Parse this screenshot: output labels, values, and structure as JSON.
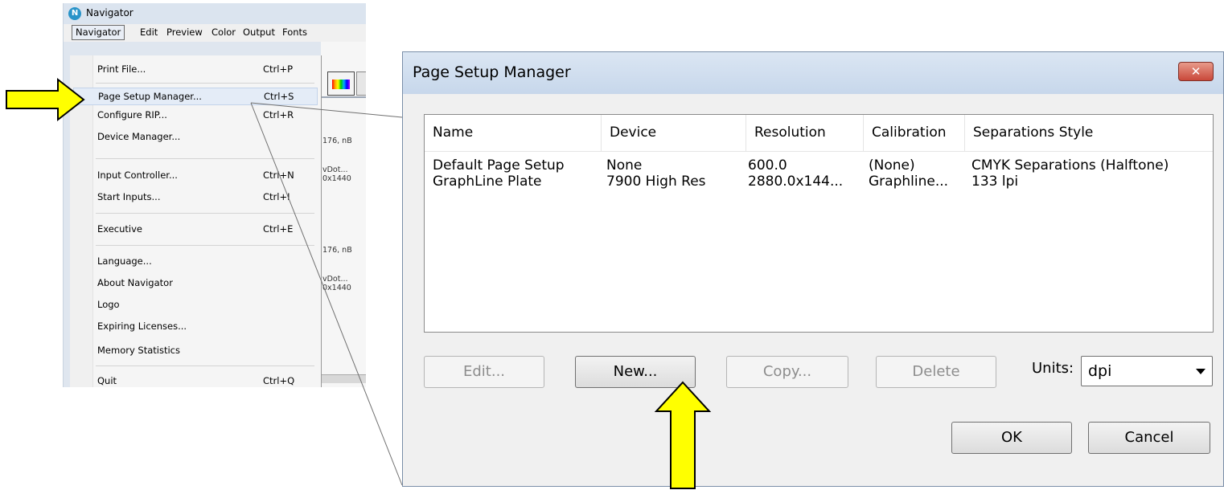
{
  "navigator_window": {
    "title": "Navigator",
    "logo_letter": "N",
    "menubar": [
      "Navigator",
      "Edit",
      "Preview",
      "Color",
      "Output",
      "Fonts"
    ],
    "background_text": [
      "176, nB",
      "vDot...",
      "0x1440",
      "176, nB",
      "vDot...",
      "0x1440"
    ]
  },
  "navigator_menu": {
    "items": [
      {
        "label": "Print File...",
        "shortcut": "Ctrl+P"
      },
      {
        "label": "Page Setup Manager...",
        "shortcut": "Ctrl+S"
      },
      {
        "label": "Configure RIP...",
        "shortcut": "Ctrl+R"
      },
      {
        "label": "Device Manager...",
        "shortcut": ""
      },
      {
        "label": "Input Controller...",
        "shortcut": "Ctrl+N"
      },
      {
        "label": "Start Inputs...",
        "shortcut": "Ctrl+I"
      },
      {
        "label": "Executive",
        "shortcut": "Ctrl+E"
      },
      {
        "label": "Language...",
        "shortcut": ""
      },
      {
        "label": "About Navigator",
        "shortcut": ""
      },
      {
        "label": "Logo",
        "shortcut": ""
      },
      {
        "label": "Expiring Licenses...",
        "shortcut": ""
      },
      {
        "label": "Memory Statistics",
        "shortcut": ""
      },
      {
        "label": "Quit",
        "shortcut": "Ctrl+Q"
      }
    ]
  },
  "dialog": {
    "title": "Page Setup Manager",
    "close_label": "✕",
    "columns": [
      "Name",
      "Device",
      "Resolution",
      "Calibration",
      "Separations Style"
    ],
    "rows": [
      [
        "Default Page Setup",
        "None",
        "600.0",
        "(None)",
        "CMYK Separations (Halftone)"
      ],
      [
        "GraphLine Plate",
        "7900 High Res",
        "2880.0x144...",
        "Graphline...",
        "133 lpi"
      ]
    ],
    "buttons": {
      "edit": "Edit...",
      "new": "New...",
      "copy": "Copy...",
      "delete": "Delete",
      "ok": "OK",
      "cancel": "Cancel"
    },
    "units_label": "Units:",
    "units_value": "dpi"
  },
  "colors": {
    "arrow_fill": "#ffff00",
    "arrow_stroke": "#000000",
    "menu_highlight": "#e4ecf7"
  }
}
